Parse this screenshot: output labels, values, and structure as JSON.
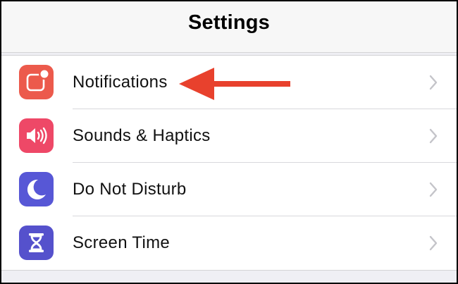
{
  "header": {
    "title": "Settings"
  },
  "settings_rows": [
    {
      "label": "Notifications",
      "icon": "notifications-icon",
      "color": "#ec5a4c"
    },
    {
      "label": "Sounds & Haptics",
      "icon": "speaker-icon",
      "color": "#ee4867"
    },
    {
      "label": "Do Not Disturb",
      "icon": "moon-icon",
      "color": "#5757d6"
    },
    {
      "label": "Screen Time",
      "icon": "hourglass-icon",
      "color": "#5551cc"
    }
  ],
  "annotation": {
    "arrow_color": "#e8412d"
  }
}
